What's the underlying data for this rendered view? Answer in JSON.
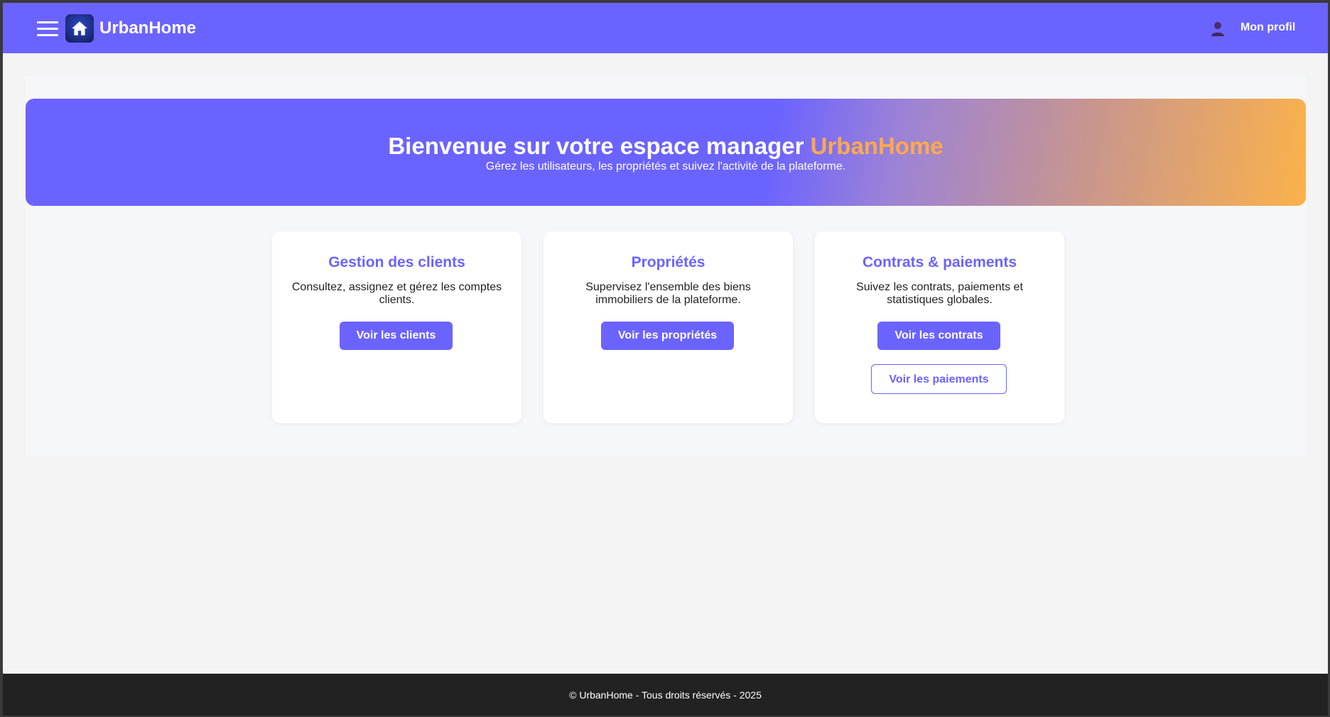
{
  "header": {
    "brand": "UrbanHome",
    "profile_label": "Mon profil"
  },
  "hero": {
    "title_prefix": "Bienvenue sur votre espace manager ",
    "title_accent": "UrbanHome",
    "subtitle": "Gérez les utilisateurs, les propriétés et suivez l'activité de la plateforme."
  },
  "cards": [
    {
      "title": "Gestion des clients",
      "text": "Consultez, assignez et gérez les comptes clients.",
      "primary_button": "Voir les clients"
    },
    {
      "title": "Propriétés",
      "text": "Supervisez l'ensemble des biens immobiliers de la plateforme.",
      "primary_button": "Voir les propriétés"
    },
    {
      "title": "Contrats & paiements",
      "text": "Suivez les contrats, paiements et statistiques globales.",
      "primary_button": "Voir les contrats",
      "secondary_button": "Voir les paiements"
    }
  ],
  "footer": {
    "text": "© UrbanHome - Tous droits réservés - 2025"
  },
  "colors": {
    "primary": "#6b63ff",
    "accent": "#ffa94d",
    "footer_bg": "#222222"
  },
  "icons": [
    "menu-icon",
    "home-icon",
    "user-icon"
  ]
}
